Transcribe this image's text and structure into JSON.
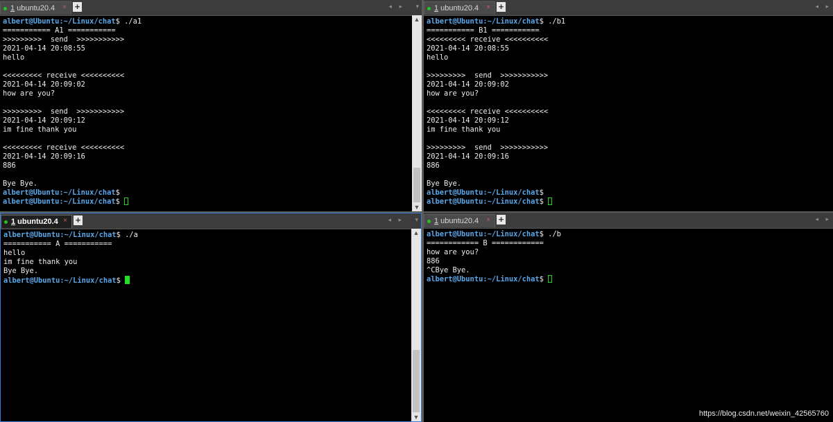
{
  "panes": [
    {
      "tab": {
        "num": "1",
        "title": "ubuntu20.4",
        "active": false
      },
      "lines": [
        [
          {
            "t": "albert@Ubuntu:~/Linux/chat",
            "p": 1
          },
          {
            "t": "$ ./a1"
          }
        ],
        [
          {
            "t": "=========== A1 ==========="
          }
        ],
        [
          {
            "t": ">>>>>>>>>  send  >>>>>>>>>>>"
          }
        ],
        [
          {
            "t": "2021-04-14 20:08:55"
          }
        ],
        [
          {
            "t": "hello"
          }
        ],
        [
          {
            "t": ""
          }
        ],
        [
          {
            "t": "<<<<<<<<< receive <<<<<<<<<<"
          }
        ],
        [
          {
            "t": "2021-04-14 20:09:02"
          }
        ],
        [
          {
            "t": "how are you?"
          }
        ],
        [
          {
            "t": ""
          }
        ],
        [
          {
            "t": ">>>>>>>>>  send  >>>>>>>>>>>"
          }
        ],
        [
          {
            "t": "2021-04-14 20:09:12"
          }
        ],
        [
          {
            "t": "im fine thank you"
          }
        ],
        [
          {
            "t": ""
          }
        ],
        [
          {
            "t": "<<<<<<<<< receive <<<<<<<<<<"
          }
        ],
        [
          {
            "t": "2021-04-14 20:09:16"
          }
        ],
        [
          {
            "t": "886"
          }
        ],
        [
          {
            "t": ""
          }
        ],
        [
          {
            "t": "Bye Bye."
          }
        ],
        [
          {
            "t": "albert@Ubuntu:~/Linux/chat",
            "p": 1
          },
          {
            "t": "$"
          }
        ],
        [
          {
            "t": "albert@Ubuntu:~/Linux/chat",
            "p": 1
          },
          {
            "t": "$ "
          },
          {
            "c": "outline"
          }
        ]
      ]
    },
    {
      "tab": {
        "num": "1",
        "title": "ubuntu20.4",
        "active": false
      },
      "lines": [
        [
          {
            "t": "albert@Ubuntu:~/Linux/chat",
            "p": 1
          },
          {
            "t": "$ ./b1"
          }
        ],
        [
          {
            "t": "=========== B1 ==========="
          }
        ],
        [
          {
            "t": "<<<<<<<<< receive <<<<<<<<<<"
          }
        ],
        [
          {
            "t": "2021-04-14 20:08:55"
          }
        ],
        [
          {
            "t": "hello"
          }
        ],
        [
          {
            "t": ""
          }
        ],
        [
          {
            "t": ">>>>>>>>>  send  >>>>>>>>>>>"
          }
        ],
        [
          {
            "t": "2021-04-14 20:09:02"
          }
        ],
        [
          {
            "t": "how are you?"
          }
        ],
        [
          {
            "t": ""
          }
        ],
        [
          {
            "t": "<<<<<<<<< receive <<<<<<<<<<"
          }
        ],
        [
          {
            "t": "2021-04-14 20:09:12"
          }
        ],
        [
          {
            "t": "im fine thank you"
          }
        ],
        [
          {
            "t": ""
          }
        ],
        [
          {
            "t": ">>>>>>>>>  send  >>>>>>>>>>>"
          }
        ],
        [
          {
            "t": "2021-04-14 20:09:16"
          }
        ],
        [
          {
            "t": "886"
          }
        ],
        [
          {
            "t": ""
          }
        ],
        [
          {
            "t": "Bye Bye."
          }
        ],
        [
          {
            "t": "albert@Ubuntu:~/Linux/chat",
            "p": 1
          },
          {
            "t": "$"
          }
        ],
        [
          {
            "t": "albert@Ubuntu:~/Linux/chat",
            "p": 1
          },
          {
            "t": "$ "
          },
          {
            "c": "outline"
          }
        ]
      ]
    },
    {
      "tab": {
        "num": "1",
        "title": "ubuntu20.4",
        "active": true
      },
      "lines": [
        [
          {
            "t": "albert@Ubuntu:~/Linux/chat",
            "p": 1
          },
          {
            "t": "$ ./a"
          }
        ],
        [
          {
            "t": "=========== A ==========="
          }
        ],
        [
          {
            "t": "hello"
          }
        ],
        [
          {
            "t": "im fine thank you"
          }
        ],
        [
          {
            "t": "Bye Bye."
          }
        ],
        [
          {
            "t": "albert@Ubuntu:~/Linux/chat",
            "p": 1
          },
          {
            "t": "$ "
          },
          {
            "c": "solid"
          }
        ]
      ]
    },
    {
      "tab": {
        "num": "1",
        "title": "ubuntu20.4",
        "active": false
      },
      "lines": [
        [
          {
            "t": "albert@Ubuntu:~/Linux/chat",
            "p": 1
          },
          {
            "t": "$ ./b"
          }
        ],
        [
          {
            "t": "============ B ============"
          }
        ],
        [
          {
            "t": "how are you?"
          }
        ],
        [
          {
            "t": "886"
          }
        ],
        [
          {
            "t": "^CBye Bye."
          }
        ],
        [
          {
            "t": "albert@Ubuntu:~/Linux/chat",
            "p": 1
          },
          {
            "t": "$ "
          },
          {
            "c": "outline"
          }
        ]
      ]
    }
  ],
  "tab_close_glyph": "×",
  "tab_add_glyph": "+",
  "nav_arrows": "◂ ▸",
  "dropdown_glyph": "▾",
  "scroll_up": "▲",
  "scroll_down": "▼",
  "watermark": "https://blog.csdn.net/weixin_42565760",
  "colors": {
    "prompt": "#5aa8ea",
    "cursor": "#22e022",
    "background": "#000000",
    "text": "#ececec"
  }
}
